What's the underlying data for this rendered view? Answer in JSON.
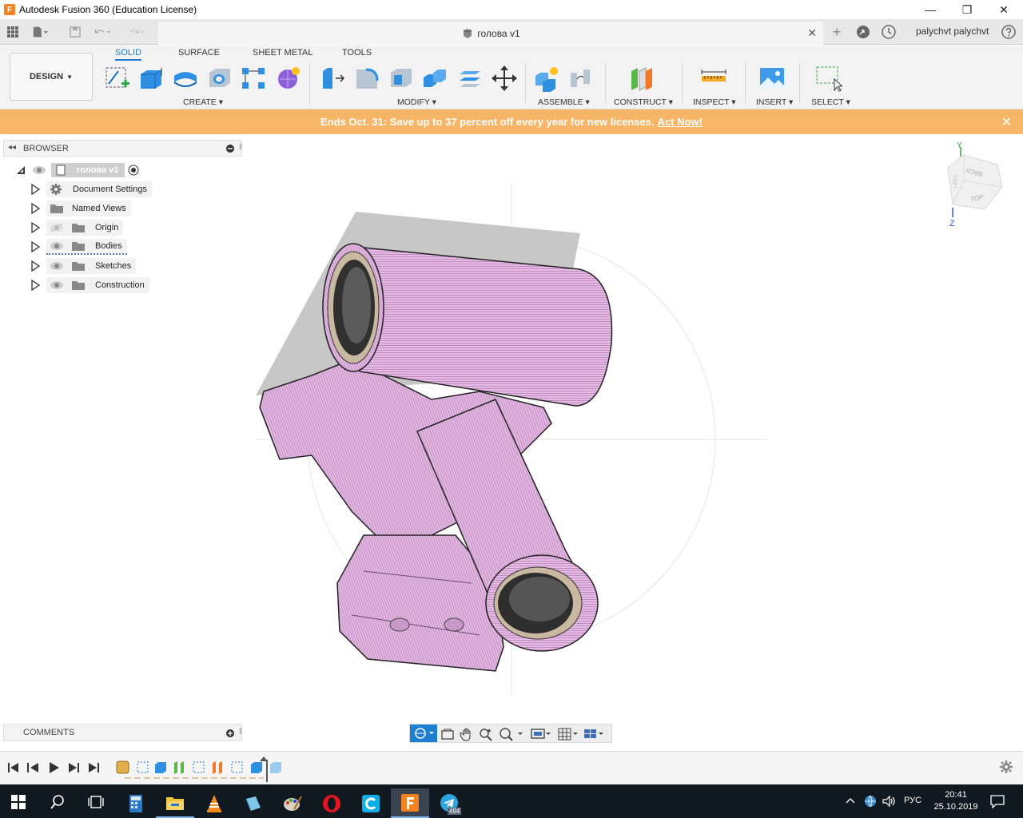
{
  "window": {
    "title": "Autodesk Fusion 360 (Education License)",
    "logo_letter": "F",
    "minimize": "—",
    "maximize": "❐",
    "close": "✕"
  },
  "tabbar": {
    "document_title": "голова v1",
    "user": "palychvt palychvt",
    "close_glyph": "✕",
    "new_tab_glyph": "+"
  },
  "toolbar": {
    "workspace": "DESIGN",
    "tabs": [
      "SOLID",
      "SURFACE",
      "SHEET METAL",
      "TOOLS"
    ],
    "active_tab": "SOLID",
    "groups": {
      "create": "CREATE",
      "modify": "MODIFY",
      "assemble": "ASSEMBLE",
      "construct": "CONSTRUCT",
      "inspect": "INSPECT",
      "insert": "INSERT",
      "select": "SELECT"
    }
  },
  "banner": {
    "text": "Ends Oct. 31: Save up to 37 percent off every year for new licenses.",
    "link": "Act Now!",
    "close_glyph": "✕"
  },
  "browser": {
    "title": "BROWSER",
    "root": "голова v1",
    "items": [
      {
        "label": "Document Settings",
        "icon": "gear-icon"
      },
      {
        "label": "Named Views",
        "icon": "folder-icon"
      },
      {
        "label": "Origin",
        "icon": "folder-icon"
      },
      {
        "label": "Bodies",
        "icon": "folder-icon"
      },
      {
        "label": "Sketches",
        "icon": "folder-icon"
      },
      {
        "label": "Construction",
        "icon": "folder-icon"
      }
    ]
  },
  "viewcube": {
    "faces": [
      "BACK",
      "TOP",
      "LEFT"
    ],
    "axes": {
      "y": "Y",
      "z": "Z"
    }
  },
  "comments": {
    "title": "COMMENTS"
  },
  "taskbar": {
    "language": "РУС",
    "time": "20:41",
    "date": "25.10.2019",
    "telegram_badge": "494"
  },
  "colors": {
    "accent": "#1e7fd0",
    "banner": "#f7b568",
    "model_body": "#e6b3e6"
  }
}
